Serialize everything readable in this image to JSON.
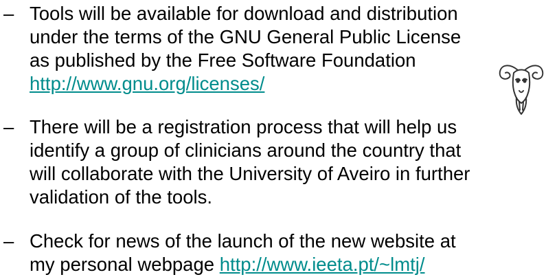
{
  "bullets": [
    {
      "dash": "–",
      "lines": [
        "Tools will be available for download and distribution",
        "under the terms of the GNU General Public License",
        "as published by the Free Software Foundation"
      ],
      "link": "http://www.gnu.org/licenses/"
    },
    {
      "dash": "–",
      "lines": [
        "There will be a registration process that will help us",
        "identify a group of clinicians around the country that",
        "will collaborate with the University of Aveiro in further",
        "validation of the tools."
      ]
    },
    {
      "dash": "–",
      "lines": [
        "Check for news of the launch of the new website at",
        "my personal webpage "
      ],
      "link": "http://www.ieeta.pt/~lmtj/"
    }
  ],
  "colors": {
    "link": "#008c8c",
    "text": "#000000"
  },
  "gnu_logo": {
    "icon": "gnu-head-icon"
  }
}
